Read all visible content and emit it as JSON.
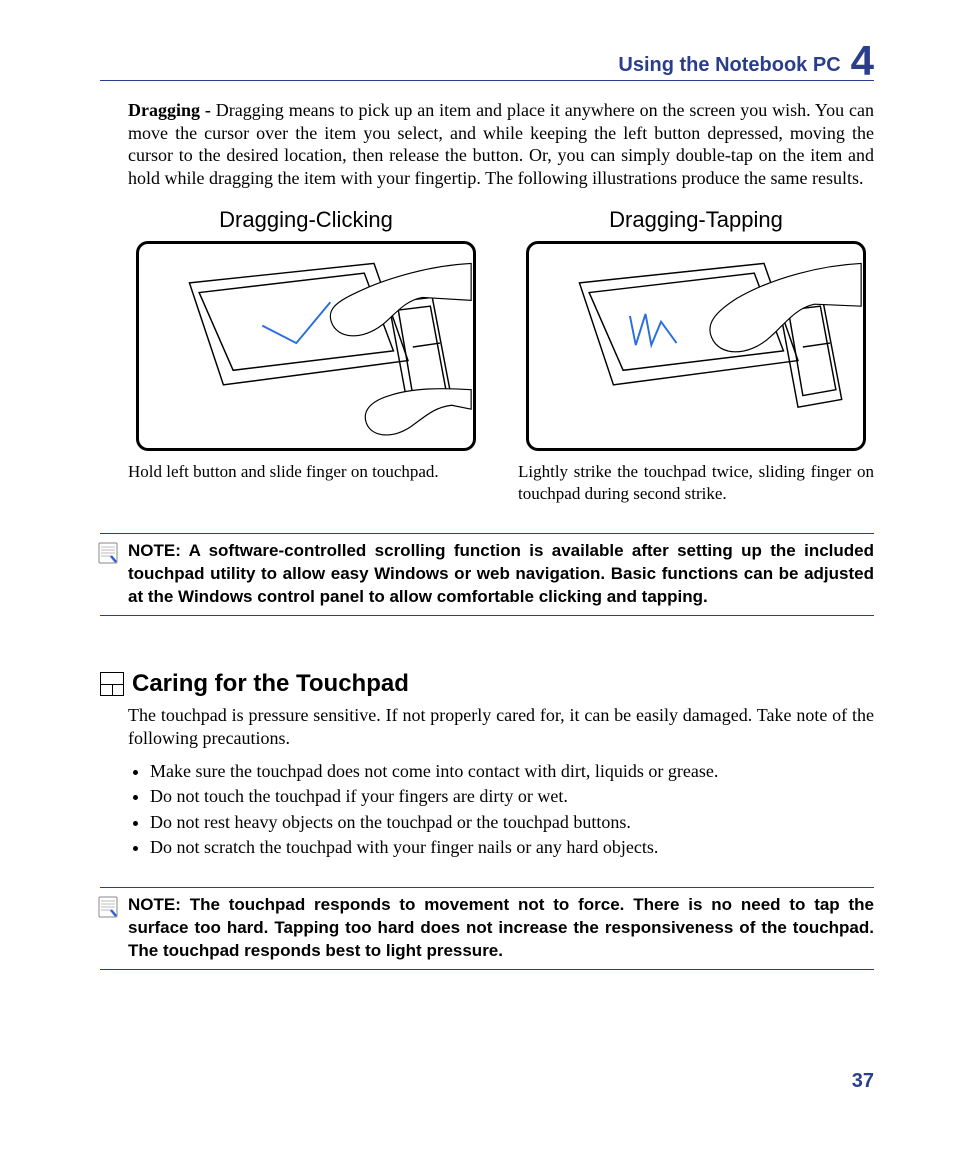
{
  "header": {
    "title": "Using the Notebook PC",
    "chapter": "4"
  },
  "main": {
    "dragging": {
      "lead": "Dragging -",
      "body": " Dragging means to pick up an item and place it anywhere on the screen you wish. You can move the cursor over the item you select, and while keeping the left button depressed, moving the cursor to the desired location, then release the button. Or, you can simply double-tap on the item and hold while dragging the item with your fingertip. The following illustrations produce the same results."
    },
    "figures": {
      "click": {
        "title": "Dragging-Clicking",
        "caption": "Hold left button and slide finger on touchpad."
      },
      "tap": {
        "title": "Dragging-Tapping",
        "caption": "Lightly strike the touchpad twice, sliding finger on touchpad during second strike."
      }
    },
    "note1": "NOTE: A software-controlled scrolling function is available after setting up the included touchpad utility to allow easy Windows or web navigation. Basic functions can be adjusted at the Windows control panel to allow comfortable clicking and tapping.",
    "caring": {
      "title": "Caring for the Touchpad",
      "intro": "The touchpad is pressure sensitive. If not properly cared for, it can be easily damaged. Take note of the following precautions.",
      "bullets": [
        "Make sure the touchpad does not come into contact with dirt, liquids or grease.",
        "Do not touch the touchpad if your fingers are dirty or wet.",
        "Do not rest heavy objects on the touchpad or the touchpad buttons.",
        "Do not scratch the touchpad with your finger nails or any hard objects."
      ]
    },
    "note2": "NOTE:  The touchpad responds to movement not to force. There is no need to tap the surface too hard. Tapping too hard does not increase the responsiveness of the touchpad. The touchpad responds best to light pressure."
  },
  "footer": {
    "page": "37"
  }
}
